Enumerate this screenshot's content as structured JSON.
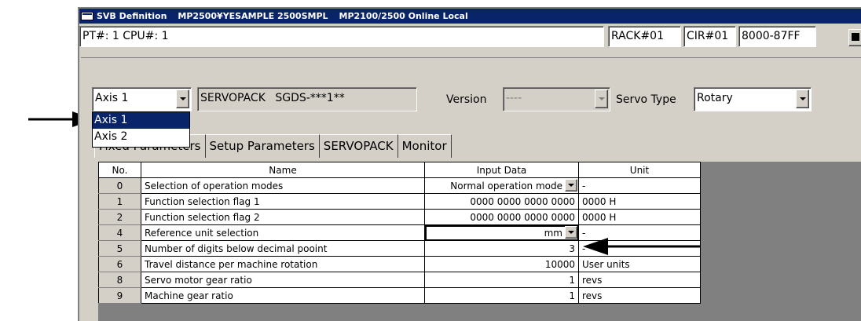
{
  "window": {
    "title_app": "SVB Definition",
    "title_path": "MP2500¥YESAMPLE 2500SMPL",
    "title_mode": "MP2100/2500 Online Local"
  },
  "status": {
    "pt_cpu": "PT#: 1 CPU#: 1",
    "rack": "RACK#01",
    "cir": "CIR#01",
    "address": "8000-87FF"
  },
  "axis_select": {
    "value": "Axis 1",
    "options": [
      "Axis 1",
      "Axis 2"
    ]
  },
  "servopack": {
    "label": "SERVOPACK",
    "model": "SGDS-***1**"
  },
  "version": {
    "label": "Version",
    "value": "----"
  },
  "servo_type": {
    "label": "Servo Type",
    "value": "Rotary"
  },
  "tabs": [
    "Fixed Parameters",
    "Setup Parameters",
    "SERVOPACK",
    "Monitor"
  ],
  "table": {
    "headers": [
      "No.",
      "Name",
      "Input Data",
      "Unit"
    ],
    "rows": [
      {
        "no": "0",
        "name": "Selection of operation modes",
        "input": "Normal operation mode",
        "unit": "-"
      },
      {
        "no": "1",
        "name": "Function selection flag 1",
        "input": "0000 0000 0000 0000",
        "unit": "0000 H"
      },
      {
        "no": "2",
        "name": "Function selection flag 2",
        "input": "0000 0000 0000 0000",
        "unit": "0000 H"
      },
      {
        "no": "4",
        "name": "Reference unit selection",
        "input": "mm",
        "unit": "-"
      },
      {
        "no": "5",
        "name": "Number of digits below decimal pooint",
        "input": "3",
        "unit": "-"
      },
      {
        "no": "6",
        "name": "Travel distance per machine rotation",
        "input": "10000",
        "unit": "User units"
      },
      {
        "no": "8",
        "name": "Servo motor gear ratio",
        "input": "1",
        "unit": "revs"
      },
      {
        "no": "9",
        "name": "Machine gear ratio",
        "input": "1",
        "unit": "revs"
      }
    ]
  },
  "colors": {
    "titlebar": "#0a246a",
    "face": "#d4d0c8",
    "selection": "#0a246a"
  }
}
